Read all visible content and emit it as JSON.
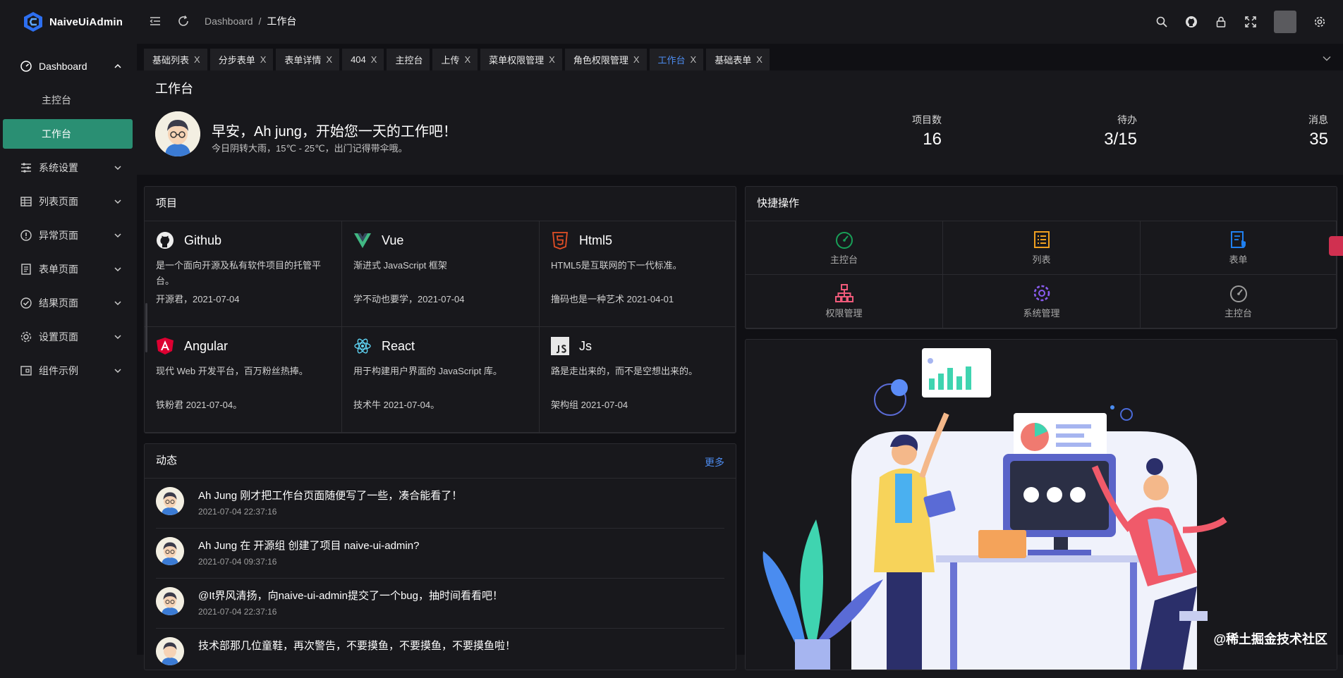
{
  "app": {
    "title": "NaiveUiAdmin"
  },
  "sidebar": {
    "items": [
      {
        "label": "Dashboard",
        "icon": "dashboard-icon",
        "expanded": true,
        "children": [
          {
            "label": "主控台",
            "active": false
          },
          {
            "label": "工作台",
            "active": true
          }
        ]
      },
      {
        "label": "系统设置",
        "icon": "sliders-icon"
      },
      {
        "label": "列表页面",
        "icon": "table-icon"
      },
      {
        "label": "异常页面",
        "icon": "exclamation-icon"
      },
      {
        "label": "表单页面",
        "icon": "form-icon"
      },
      {
        "label": "结果页面",
        "icon": "check-circle-icon"
      },
      {
        "label": "设置页面",
        "icon": "gear-icon"
      },
      {
        "label": "组件示例",
        "icon": "component-icon"
      }
    ]
  },
  "header": {
    "breadcrumb": [
      "Dashboard",
      "工作台"
    ],
    "separator": "/"
  },
  "tabs": [
    {
      "label": "基础列表",
      "closable": true
    },
    {
      "label": "分步表单",
      "closable": true
    },
    {
      "label": "表单详情",
      "closable": true
    },
    {
      "label": "404",
      "closable": true
    },
    {
      "label": "主控台",
      "closable": false
    },
    {
      "label": "上传",
      "closable": true
    },
    {
      "label": "菜单权限管理",
      "closable": true
    },
    {
      "label": "角色权限管理",
      "closable": true
    },
    {
      "label": "工作台",
      "closable": true,
      "active": true
    },
    {
      "label": "基础表单",
      "closable": true
    }
  ],
  "close_glyph": "X",
  "welcome": {
    "page_title": "工作台",
    "greeting": "早安，Ah jung，开始您一天的工作吧！",
    "weather": "今日阴转大雨，15℃ - 25℃，出门记得带伞哦。",
    "stats": [
      {
        "label": "项目数",
        "value": "16"
      },
      {
        "label": "待办",
        "value": "3/15"
      },
      {
        "label": "消息",
        "value": "35"
      }
    ]
  },
  "projects": {
    "title": "项目",
    "items": [
      {
        "name": "Github",
        "icon": "github-icon",
        "desc": "是一个面向开源及私有软件项目的托管平台。",
        "footer": "开源君，2021-07-04"
      },
      {
        "name": "Vue",
        "icon": "vue-icon",
        "desc": "渐进式 JavaScript 框架",
        "footer": "学不动也要学，2021-07-04"
      },
      {
        "name": "Html5",
        "icon": "html5-icon",
        "desc": "HTML5是互联网的下一代标准。",
        "footer": "撸码也是一种艺术 2021-04-01"
      },
      {
        "name": "Angular",
        "icon": "angular-icon",
        "desc": "现代 Web 开发平台，百万粉丝热捧。",
        "footer": "铁粉君 2021-07-04。"
      },
      {
        "name": "React",
        "icon": "react-icon",
        "desc": "用于构建用户界面的 JavaScript 库。",
        "footer": "技术牛 2021-07-04。"
      },
      {
        "name": "Js",
        "icon": "js-icon",
        "desc": "路是走出来的，而不是空想出来的。",
        "footer": "架构组 2021-07-04"
      }
    ]
  },
  "quick": {
    "title": "快捷操作",
    "items": [
      {
        "label": "主控台",
        "icon": "speedometer-icon",
        "color": "#18a058"
      },
      {
        "label": "列表",
        "icon": "list-icon",
        "color": "#f0a020"
      },
      {
        "label": "表单",
        "icon": "form-shield-icon",
        "color": "#2080f0"
      },
      {
        "label": "权限管理",
        "icon": "hierarchy-icon",
        "color": "#f05a7a"
      },
      {
        "label": "系统管理",
        "icon": "gear-icon",
        "color": "#8a5cf0"
      },
      {
        "label": "主控台",
        "icon": "speedometer-icon",
        "color": "#9c9c9c"
      }
    ]
  },
  "activity": {
    "title": "动态",
    "more": "更多",
    "items": [
      {
        "text": "Ah Jung 刚才把工作台页面随便写了一些，凑合能看了！",
        "time": "2021-07-04 22:37:16"
      },
      {
        "text": "Ah Jung 在 开源组 创建了项目 naive-ui-admin?",
        "time": "2021-07-04 09:37:16"
      },
      {
        "text": "@It界风清扬，向naive-ui-admin提交了一个bug，抽时间看看吧！",
        "time": "2021-07-04 22:37:16"
      },
      {
        "text": "技术部那几位童鞋，再次警告，不要摸鱼，不要摸鱼，不要摸鱼啦！",
        "time": ""
      }
    ]
  },
  "watermark": "@稀土掘金技术社区",
  "colors": {
    "accent": "#2a8f73",
    "link": "#4d8cf0",
    "bg": "#101014",
    "card": "#18181c"
  }
}
